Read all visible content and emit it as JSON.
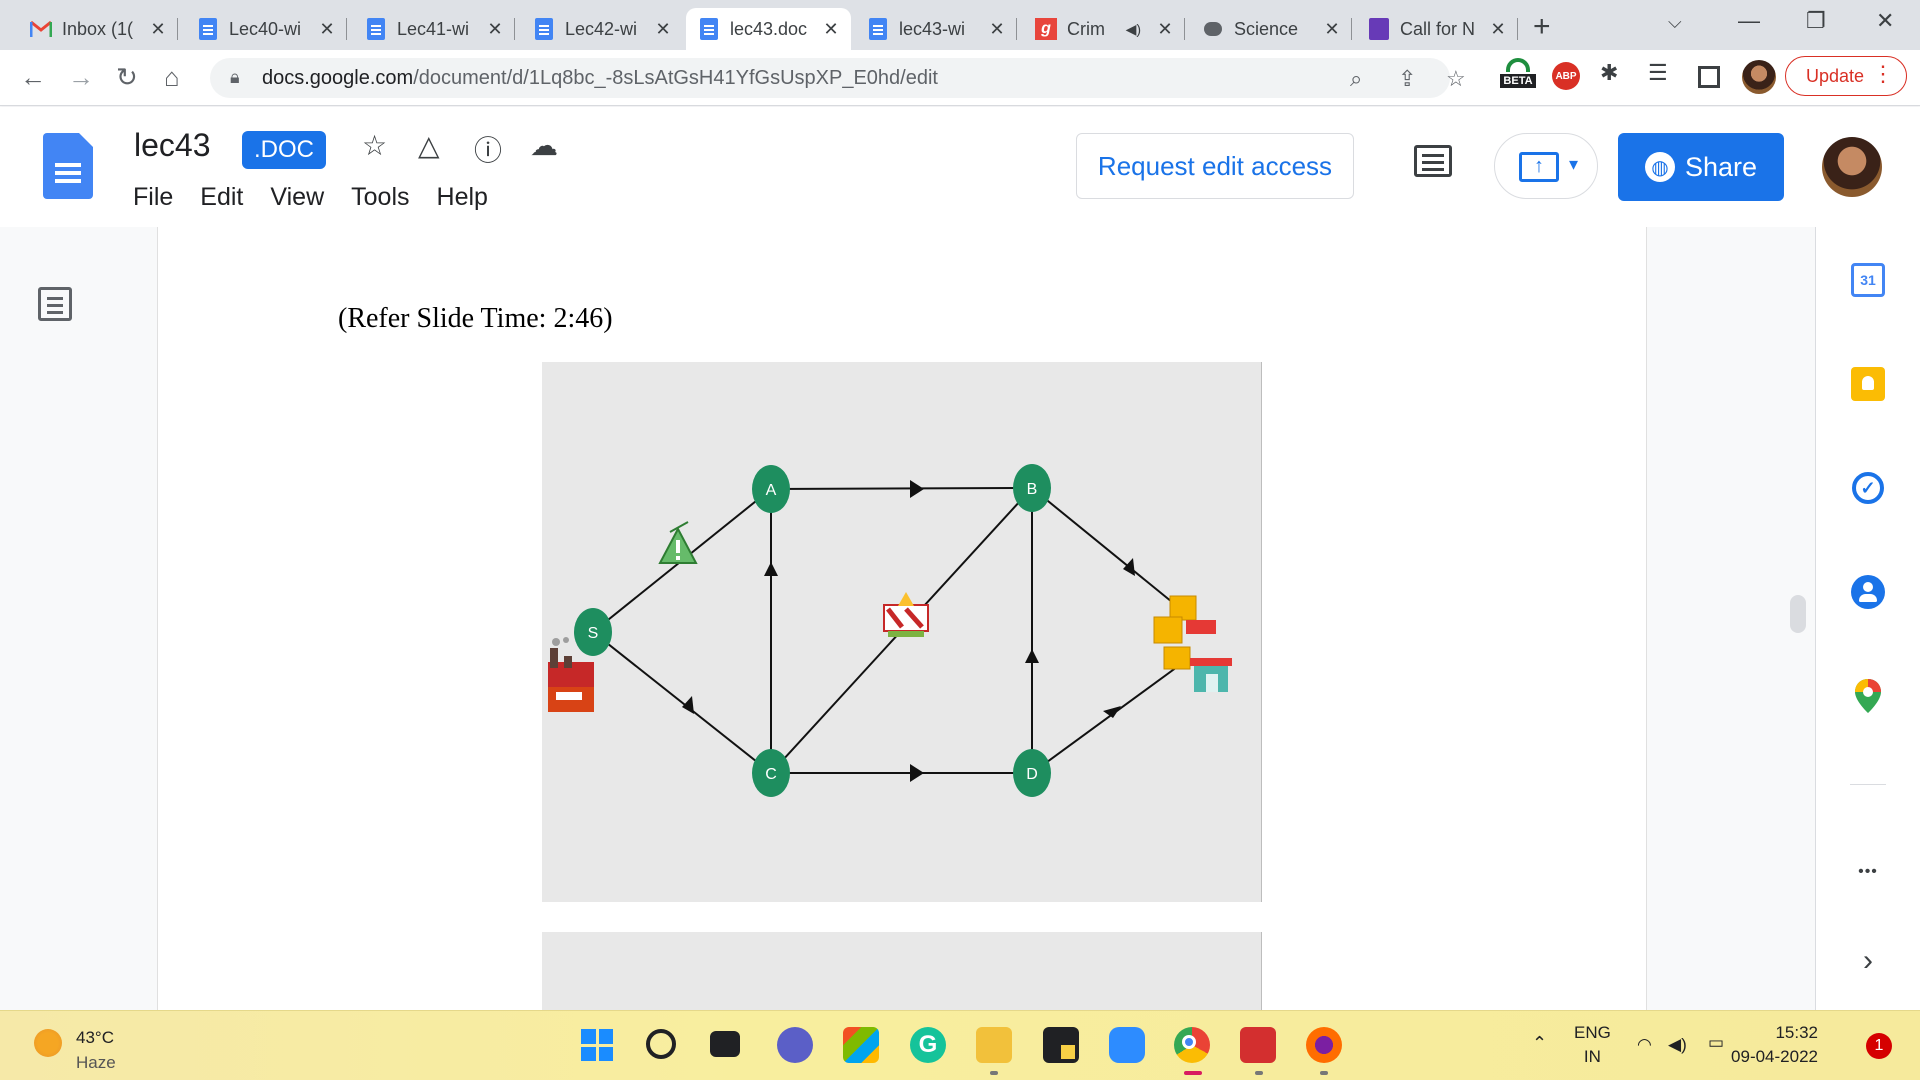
{
  "browser": {
    "tabs": [
      {
        "title": "Inbox (1(",
        "icon": "gmail-icon"
      },
      {
        "title": "Lec40-wi",
        "icon": "docs-icon"
      },
      {
        "title": "Lec41-wi",
        "icon": "docs-icon"
      },
      {
        "title": "Lec42-wi",
        "icon": "docs-icon"
      },
      {
        "title": "lec43.doc",
        "icon": "docs-icon"
      },
      {
        "title": "lec43-wi",
        "icon": "docs-icon"
      },
      {
        "title": "Crim",
        "icon": "g-icon"
      },
      {
        "title": "Science",
        "icon": "chat-icon"
      },
      {
        "title": "Call for N",
        "icon": "forms-icon"
      }
    ],
    "url_host": "docs.google.com",
    "url_path": "/document/d/1Lq8bc_-8sLsAtGsH41YfGsUspXP_E0hd/edit",
    "beta_label": "BETA",
    "abp_label": "ABP",
    "update_label": "Update"
  },
  "docs": {
    "title": "lec43",
    "badge": ".DOC",
    "menu": [
      "File",
      "Edit",
      "View",
      "Tools",
      "Help"
    ],
    "request_edit": "Request edit access",
    "share": "Share",
    "accent": "#1a73e8"
  },
  "document": {
    "slide_ref": "(Refer Slide Time: 2:46)",
    "diagram": {
      "nodes": [
        "S",
        "A",
        "B",
        "C",
        "D"
      ],
      "edges": [
        [
          "S",
          "A"
        ],
        [
          "S",
          "C"
        ],
        [
          "C",
          "A"
        ],
        [
          "A",
          "B"
        ],
        [
          "C",
          "B"
        ],
        [
          "C",
          "D"
        ],
        [
          "D",
          "B"
        ],
        [
          "B",
          "T"
        ],
        [
          "D",
          "T"
        ]
      ]
    }
  },
  "sidepanel": {
    "calendar_day": "31",
    "more": "•••",
    "expand": "›"
  },
  "taskbar": {
    "temperature": "43°C",
    "condition": "Haze",
    "lang_top": "ENG",
    "lang_bottom": "IN",
    "time": "15:32",
    "date": "09-04-2022",
    "notifications": "1"
  }
}
